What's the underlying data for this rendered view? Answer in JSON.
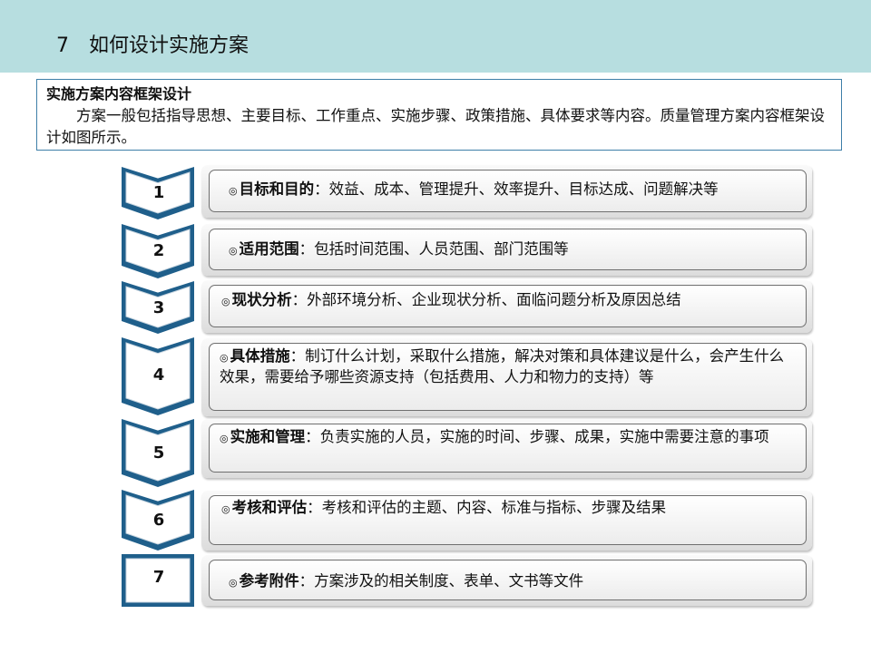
{
  "header": {
    "title": "7　如何设计实施方案",
    "bg_color": "#b7dee0"
  },
  "intro": {
    "title": "实施方案内容框架设计",
    "body": "方案一般包括指导思想、主要目标、工作重点、实施步骤、政策措施、具体要求等内容。质量管理方案内容框架设计如图所示。",
    "border_color": "#3e7fa8"
  },
  "bullet_symbol": "◎",
  "colors": {
    "chevron_dark": "#1f5f8b",
    "chevron_light": "#ffffff"
  },
  "steps": [
    {
      "number": "1",
      "keyword": "目标和目的",
      "sep": "：",
      "desc": "效益、成本、管理提升、效率提升、目标达成、问题解决等"
    },
    {
      "number": "2",
      "keyword": "适用范围",
      "sep": "：",
      "desc": "包括时间范围、人员范围、部门范围等"
    },
    {
      "number": "3",
      "keyword": "现状分析",
      "sep": "：",
      "desc": "外部环境分析、企业现状分析、面临问题分析及原因总结"
    },
    {
      "number": "4",
      "keyword": "具体措施",
      "sep": "：",
      "desc": "制订什么计划，采取什么措施，解决对策和具体建议是什么，会产生什么效果，需要给予哪些资源支持（包括费用、人力和物力的支持）等"
    },
    {
      "number": "5",
      "keyword": "实施和管理",
      "sep": "：",
      "desc": "负责实施的人员，实施的时间、步骤、成果，实施中需要注意的事项"
    },
    {
      "number": "6",
      "keyword": "考核和评估",
      "sep": "：",
      "desc": "考核和评估的主题、内容、标准与指标、步骤及结果"
    },
    {
      "number": "7",
      "keyword": "参考附件",
      "sep": "：",
      "desc": "方案涉及的相关制度、表单、文书等文件"
    }
  ]
}
